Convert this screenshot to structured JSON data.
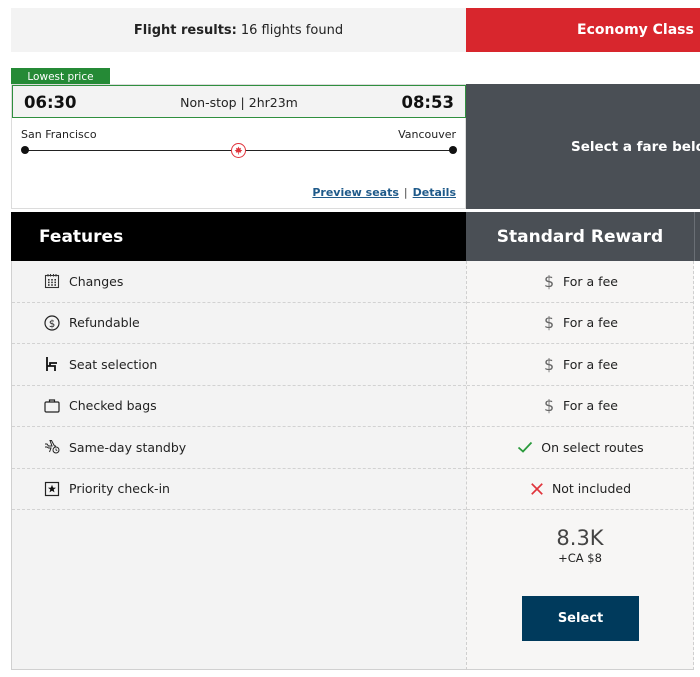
{
  "header": {
    "results_label": "Flight results:",
    "results_count": "16 flights found",
    "cabin": "Economy Class"
  },
  "flight": {
    "badge": "Lowest price",
    "departure_time": "06:30",
    "arrival_time": "08:53",
    "duration": "Non-stop | 2hr23m",
    "origin": "San Francisco",
    "destination": "Vancouver",
    "airline_icon": "maple-leaf-logo",
    "links": {
      "preview_seats": "Preview seats",
      "separator": "|",
      "details": "Details"
    }
  },
  "fare_prompt": "Select a fare below",
  "features": {
    "title": "Features",
    "items": [
      {
        "label": "Changes",
        "icon": "calendar-icon"
      },
      {
        "label": "Refundable",
        "icon": "dollar-circle-icon"
      },
      {
        "label": "Seat selection",
        "icon": "seat-icon"
      },
      {
        "label": "Checked bags",
        "icon": "suitcase-icon"
      },
      {
        "label": "Same-day standby",
        "icon": "plane-clock-icon"
      },
      {
        "label": "Priority check-in",
        "icon": "star-box-icon"
      }
    ]
  },
  "fare": {
    "name": "Standard Reward",
    "values": [
      {
        "text": "For a fee",
        "status": "fee"
      },
      {
        "text": "For a fee",
        "status": "fee"
      },
      {
        "text": "For a fee",
        "status": "fee"
      },
      {
        "text": "For a fee",
        "status": "fee"
      },
      {
        "text": "On select routes",
        "status": "included"
      },
      {
        "text": "Not included",
        "status": "excluded"
      }
    ],
    "points": "8.3K",
    "cash": "+CA $8",
    "select_label": "Select",
    "fee_symbol": "$"
  },
  "colors": {
    "cabin_red": "#d8262d",
    "badge_green": "#258a36",
    "dark_slate": "#4a4f55",
    "select_navy": "#003a5c",
    "check_green": "#2a9a3c",
    "cross_red": "#e0333b",
    "link_blue": "#1f5a8a"
  }
}
